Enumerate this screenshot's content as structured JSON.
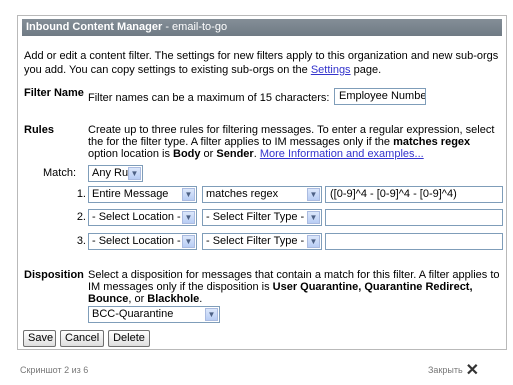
{
  "window": {
    "title_bold": "Inbound Content Manager",
    "title_rest": " - email-to-go"
  },
  "intro": {
    "text_before_link": "Add or edit a content filter. The settings for new filters apply to this organization and new sub-orgs you add. You can copy settings to existing sub-orgs on the ",
    "link": "Settings",
    "text_after_link": " page."
  },
  "filter_name": {
    "label": "Filter Name",
    "hint": "Filter names can be a maximum of 15 characters:",
    "value": "Employee Number"
  },
  "rules": {
    "label": "Rules",
    "desc_1": "Create up to three rules for filtering messages. To enter a regular expression, select the for the filter type. A filter applies to IM messages only if the ",
    "desc_bold_1": "matches regex",
    "desc_2": " option location is ",
    "desc_bold_2": "Body",
    "desc_3": " or ",
    "desc_bold_3": "Sender",
    "desc_4": ". ",
    "more_link": "More Information and examples...",
    "match_label": "Match:",
    "match_value": "Any Rule",
    "rows": [
      {
        "num": "1.",
        "location": "Entire Message",
        "type": "matches regex",
        "value": "([0-9]^4 - [0-9]^4 - [0-9]^4)"
      },
      {
        "num": "2.",
        "location": "- Select Location -",
        "type": "- Select Filter Type -",
        "value": ""
      },
      {
        "num": "3.",
        "location": "- Select Location -",
        "type": "- Select Filter Type -",
        "value": ""
      }
    ]
  },
  "disposition": {
    "label": "Disposition",
    "desc_1": "Select a disposition for messages that contain a match for this filter. A filter applies to IM messages only if the disposition is ",
    "desc_bold": "User Quarantine, Quarantine Redirect, Bounce",
    "desc_2": ", or ",
    "desc_bold_2": "Blackhole",
    "desc_3": ".",
    "value": "BCC-Quarantine"
  },
  "buttons": {
    "save": "Save",
    "cancel": "Cancel",
    "delete": "Delete"
  },
  "footer": {
    "counter": "Скриншот 2 из 6",
    "close": "Закрыть"
  }
}
